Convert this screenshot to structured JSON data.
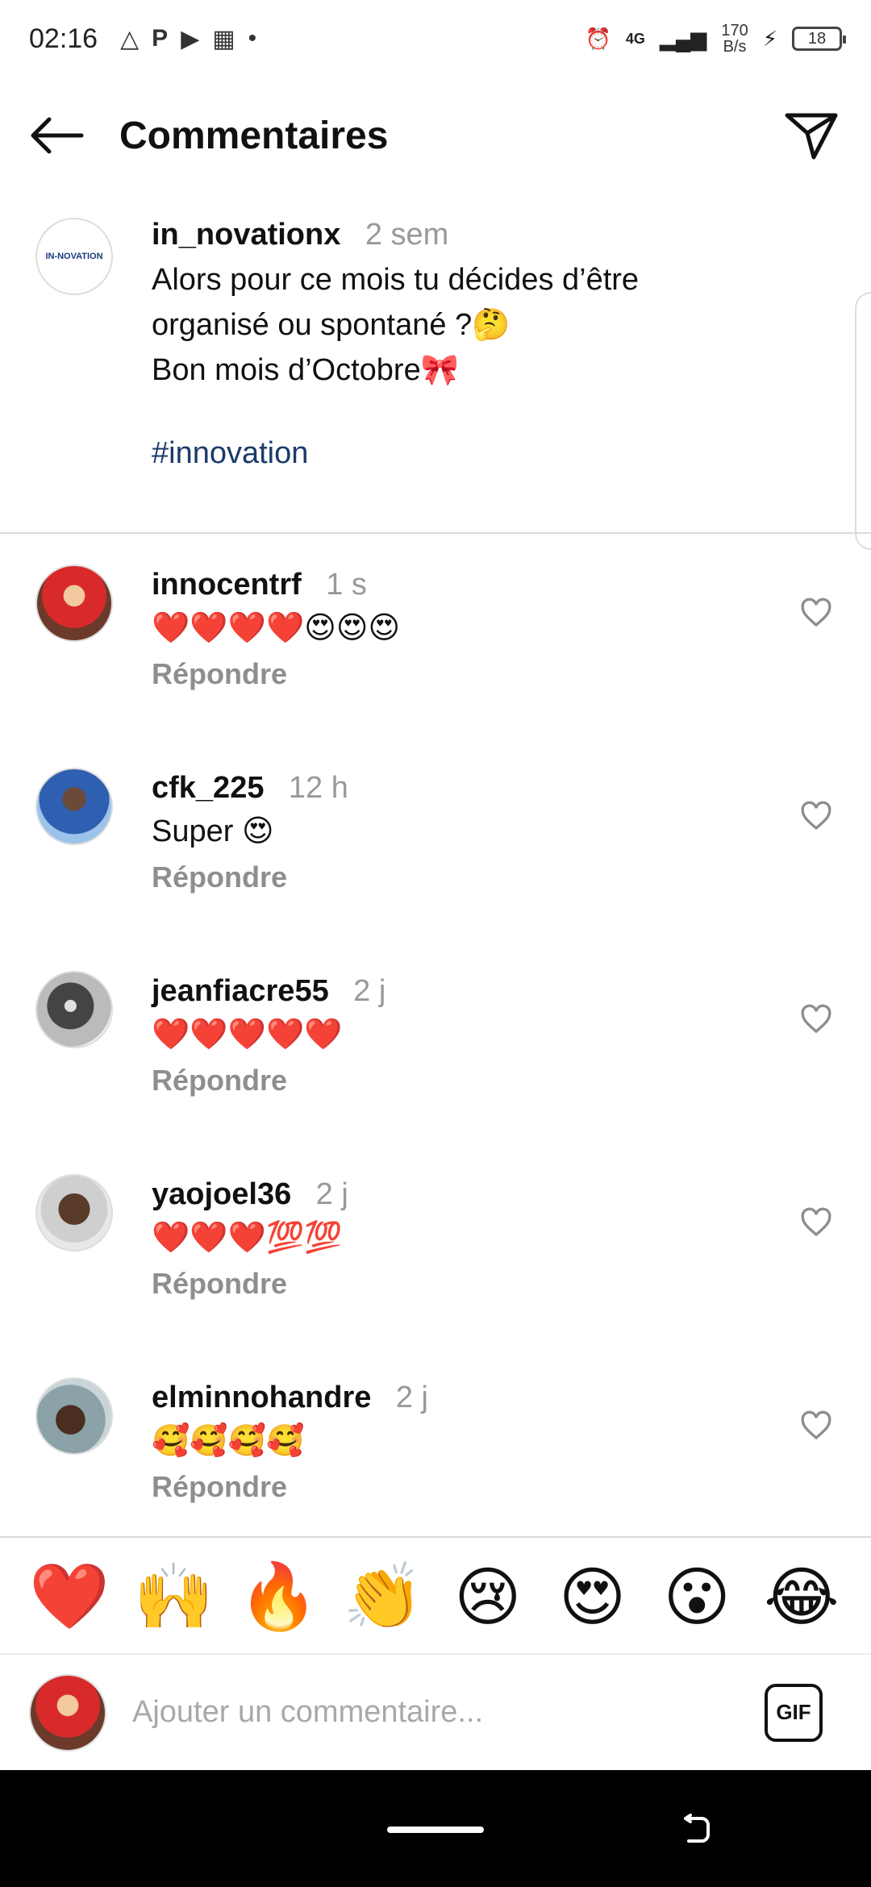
{
  "status_bar": {
    "time": "02:16",
    "network": "4G",
    "speed": "170\nB/s",
    "battery": "18"
  },
  "header": {
    "title": "Commentaires"
  },
  "post": {
    "username": "in_novationx",
    "time": "2 sem",
    "text": "Alors pour ce mois tu décides d’être\norganisé ou spontané ?🤔\nBon mois d’Octobre🎀",
    "hashtag": "#innovation",
    "avatar_text": "IN-NOVATION"
  },
  "comments": [
    {
      "username": "innocentrf",
      "time": "1 s",
      "text": "❤️❤️❤️❤️😍😍😍",
      "reply": "Répondre"
    },
    {
      "username": "cfk_225",
      "time": "12 h",
      "text": "Super 😍",
      "reply": "Répondre"
    },
    {
      "username": "jeanfiacre55",
      "time": "2 j",
      "text": "❤️❤️❤️❤️❤️",
      "reply": "Répondre"
    },
    {
      "username": "yaojoel36",
      "time": "2 j",
      "text": "❤️❤️❤️💯💯",
      "reply": "Répondre"
    },
    {
      "username": "elminnohandre",
      "time": "2 j",
      "text": "🥰🥰🥰🥰",
      "reply": "Répondre"
    }
  ],
  "reactions": [
    "❤️",
    "🙌",
    "🔥",
    "👏",
    "😢",
    "😍",
    "😮",
    "😂"
  ],
  "input": {
    "placeholder": "Ajouter un commentaire...",
    "gif_label": "GIF"
  },
  "colors": {
    "hashtag": "#1b3a6b",
    "muted": "#8e8e8e",
    "divider": "#dbdbdb"
  }
}
